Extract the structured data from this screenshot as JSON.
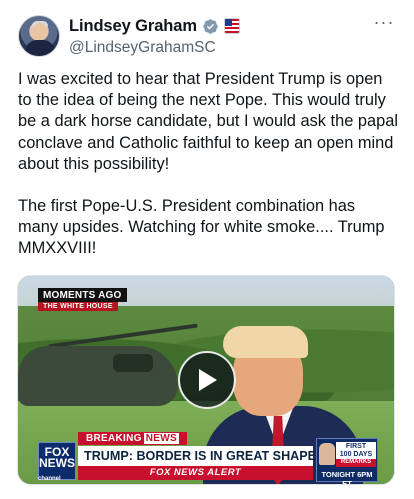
{
  "author": {
    "display_name": "Lindsey Graham",
    "handle": "@LindseyGrahamSC",
    "avatar_icon": "profile-photo",
    "verified_color": "#829aab"
  },
  "more_menu_label": "···",
  "tweet": {
    "paragraph_1": "I was excited to hear that President Trump is open to the idea of being the next Pope. This would truly be a dark horse candidate, but I would ask the papal conclave and Catholic faithful to keep an open mind about this possibility!",
    "paragraph_2": "The first Pope-U.S. President combination has many upsides. Watching for white smoke.... Trump MMXXVIII!"
  },
  "media": {
    "moments_ago": "MOMENTS AGO",
    "location": "THE WHITE HOUSE",
    "breaking_label": "BREAKING",
    "breaking_news": "NEWS",
    "headline": "TRUMP: BORDER IS IN GREAT SHAPE",
    "alert": "FOX NEWS ALERT",
    "logo_line1": "FOX",
    "logo_line2": "NEWS",
    "logo_line3": "channel",
    "promo_first": "FIRST",
    "promo_days": "100 DAYS",
    "promo_remarks": "REMARKS",
    "promo_time": "TONIGHT 6PM ET",
    "play_icon": "play-icon"
  },
  "colors": {
    "text_primary": "#0f1419",
    "text_secondary": "#536471",
    "fox_red": "#c8102e",
    "fox_blue": "#0c2b6b"
  }
}
